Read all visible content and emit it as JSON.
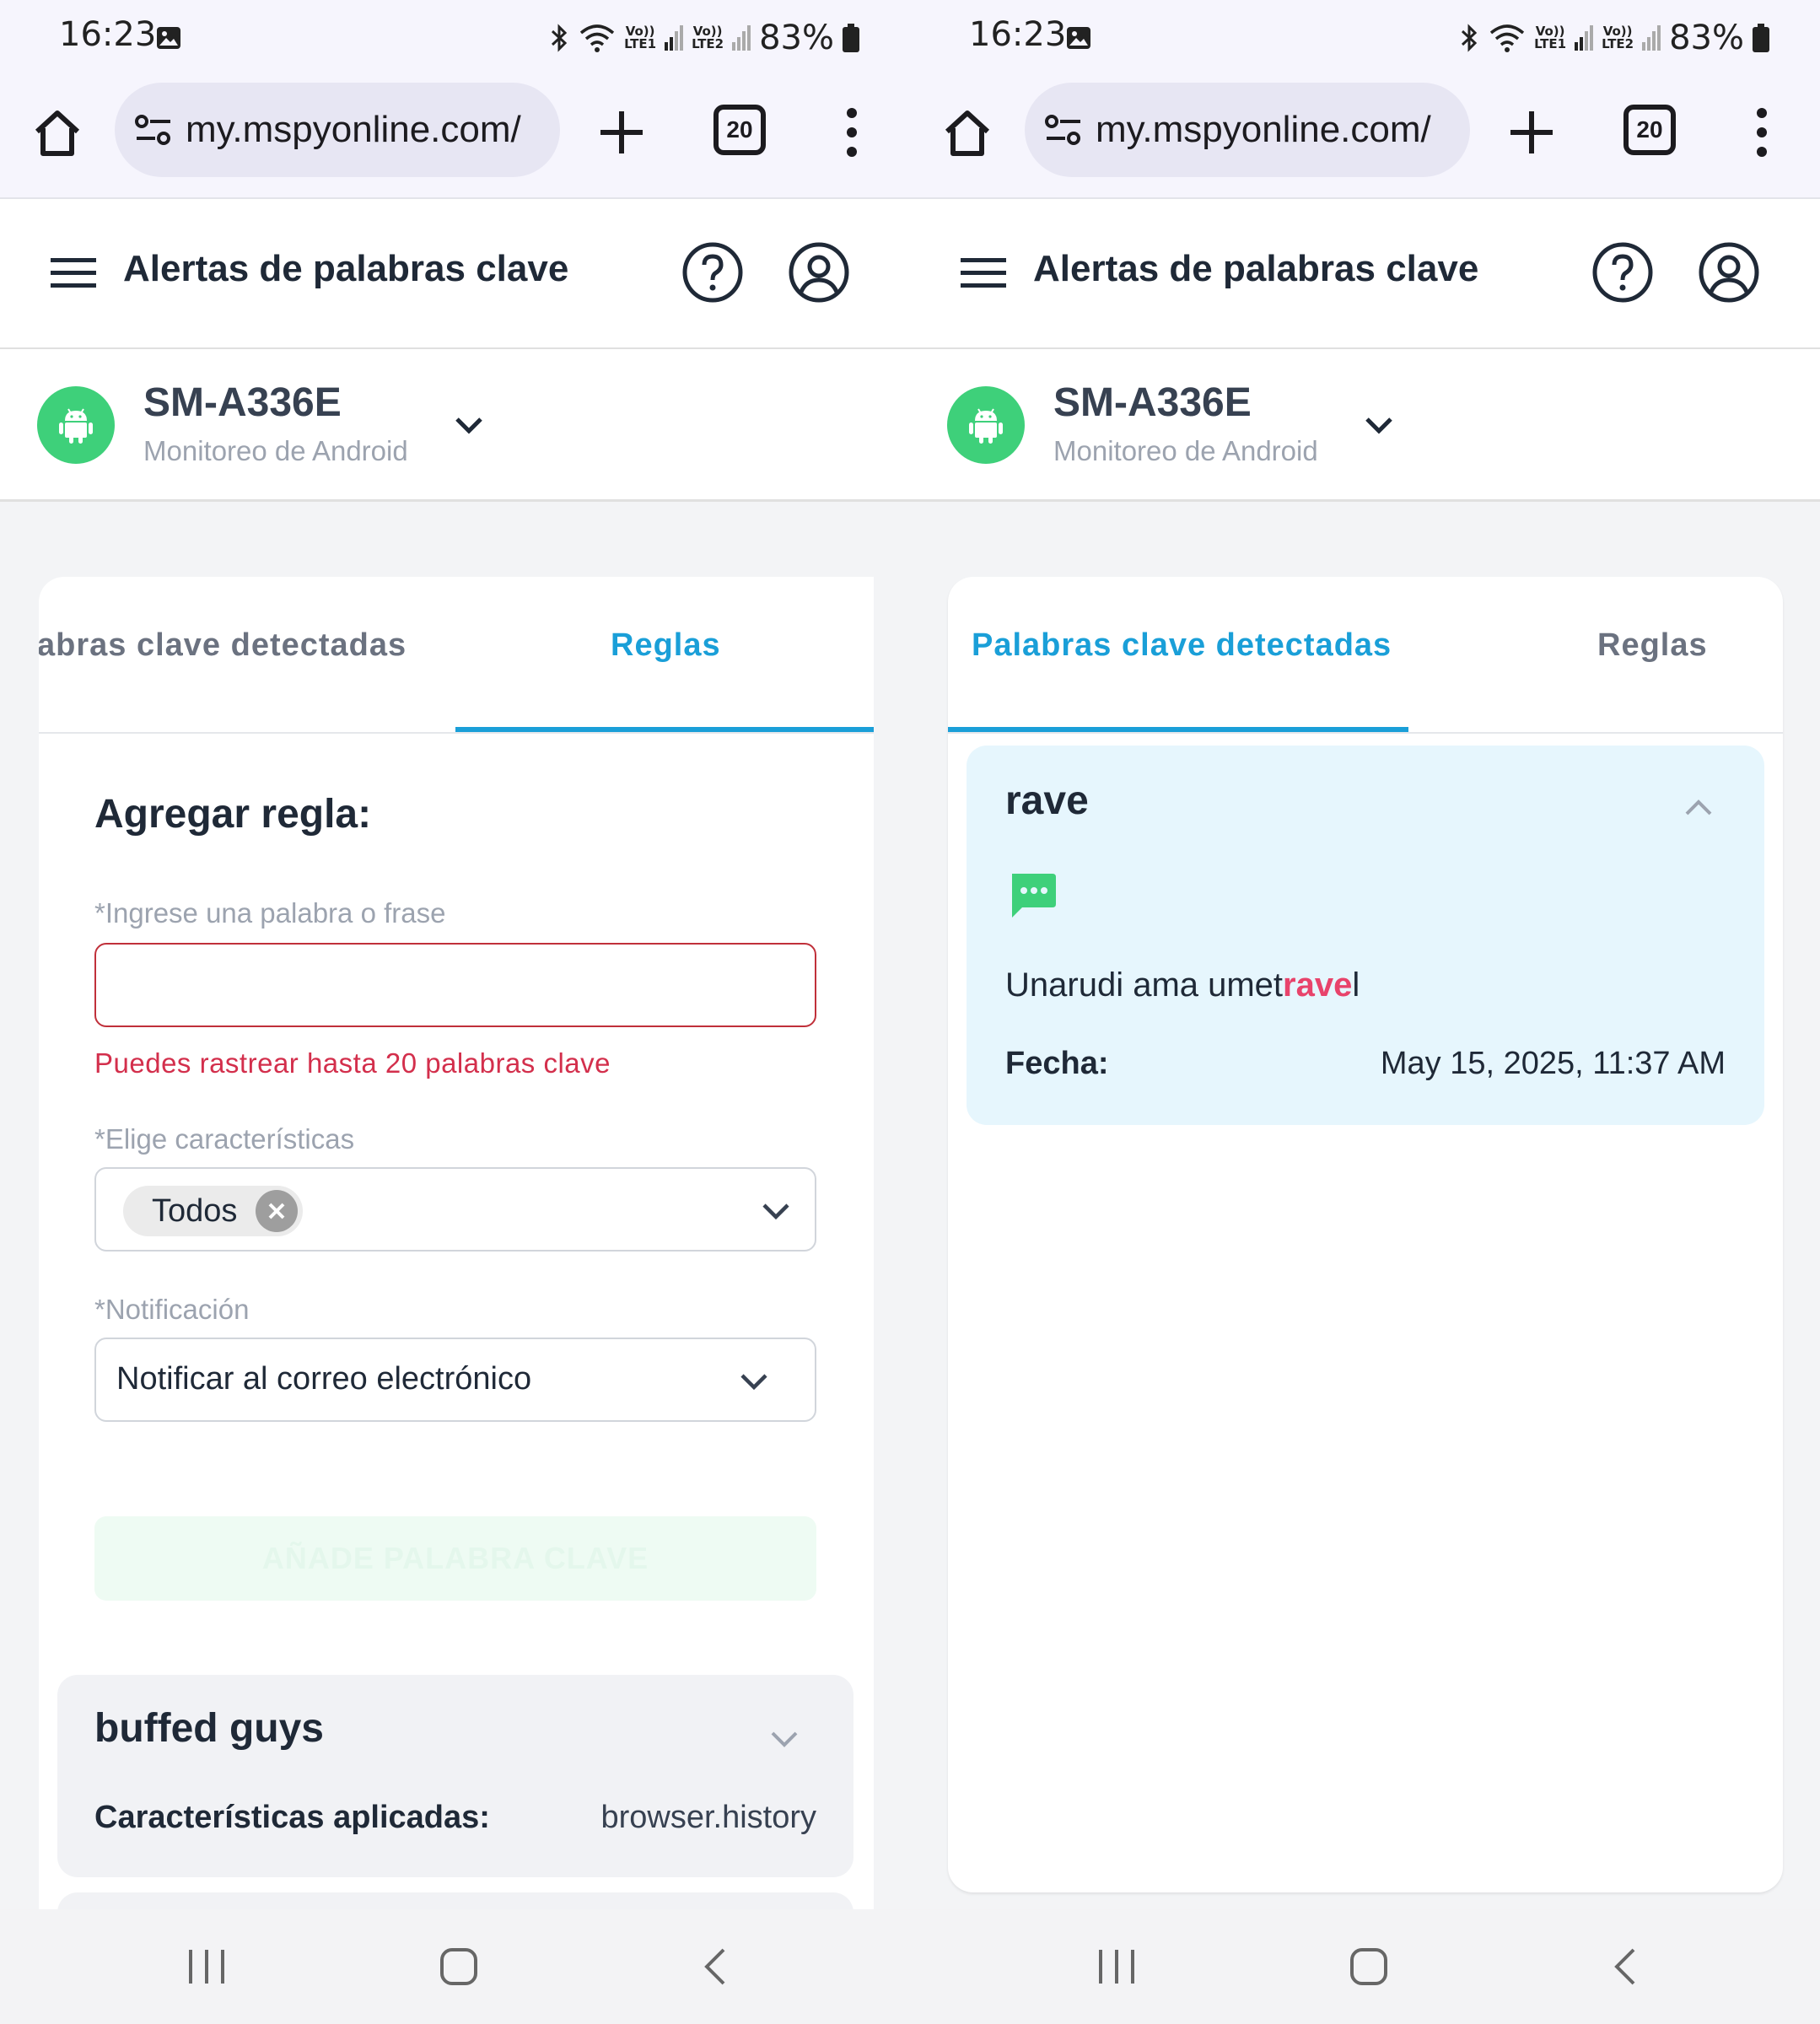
{
  "screens": [
    {
      "status": {
        "time": "16:23",
        "battery": "83%",
        "lte1": "LTE1",
        "lte2": "LTE2",
        "volte": "Vo))"
      },
      "browser": {
        "url": "my.mspyonline.com/",
        "tab_count": "20"
      },
      "header": {
        "title": "Alertas de palabras clave"
      },
      "device": {
        "name": "SM-A336E",
        "subtitle": "Monitoreo de Android"
      },
      "tabs": [
        {
          "label": "abras clave detectadas",
          "active": false
        },
        {
          "label": "Reglas",
          "active": true
        }
      ],
      "form": {
        "title": "Agregar regla:",
        "word_label": "*Ingrese una palabra o frase",
        "word_value": "",
        "error": "Puedes rastrear hasta 20 palabras clave",
        "features_label": "*Elige características",
        "features_chip": "Todos",
        "notification_label": "*Notificación",
        "notification_value": "Notificar al correo electrónico",
        "submit_label": "AÑADE PALABRA CLAVE"
      },
      "rules": [
        {
          "keyword": "buffed guys",
          "features_label": "Características aplicadas:",
          "features_value": "browser.history"
        }
      ]
    },
    {
      "status": {
        "time": "16:23",
        "battery": "83%",
        "lte1": "LTE1",
        "lte2": "LTE2",
        "volte": "Vo))"
      },
      "browser": {
        "url": "my.mspyonline.com/",
        "tab_count": "20"
      },
      "header": {
        "title": "Alertas de palabras clave"
      },
      "device": {
        "name": "SM-A336E",
        "subtitle": "Monitoreo de Android"
      },
      "tabs": [
        {
          "label": "Palabras clave detectadas",
          "active": true
        },
        {
          "label": "Reglas",
          "active": false
        }
      ],
      "detected": [
        {
          "keyword": "rave",
          "snippet_before": "Unarudi ama umet",
          "snippet_match": "rave",
          "snippet_after": "l",
          "date_label": "Fecha:",
          "date_value": "May 15, 2025, 11:37 AM"
        }
      ]
    }
  ],
  "colors": {
    "accent": "#1a9fd8",
    "android_green": "#3ed07a",
    "error": "#d32f4c",
    "highlight": "#e8436b",
    "keyword_card_bg": "#e6f6fd"
  },
  "icons": [
    "image-icon",
    "bluetooth-icon",
    "wifi-icon",
    "signal-icon",
    "battery-icon",
    "home-icon",
    "site-settings-icon",
    "plus-icon",
    "tabs-icon",
    "more-vert-icon",
    "menu-icon",
    "help-icon",
    "account-icon",
    "android-icon",
    "chevron-down-icon",
    "chevron-up-icon",
    "close-icon",
    "sms-icon",
    "nav-recents-icon",
    "nav-home-icon",
    "nav-back-icon"
  ]
}
